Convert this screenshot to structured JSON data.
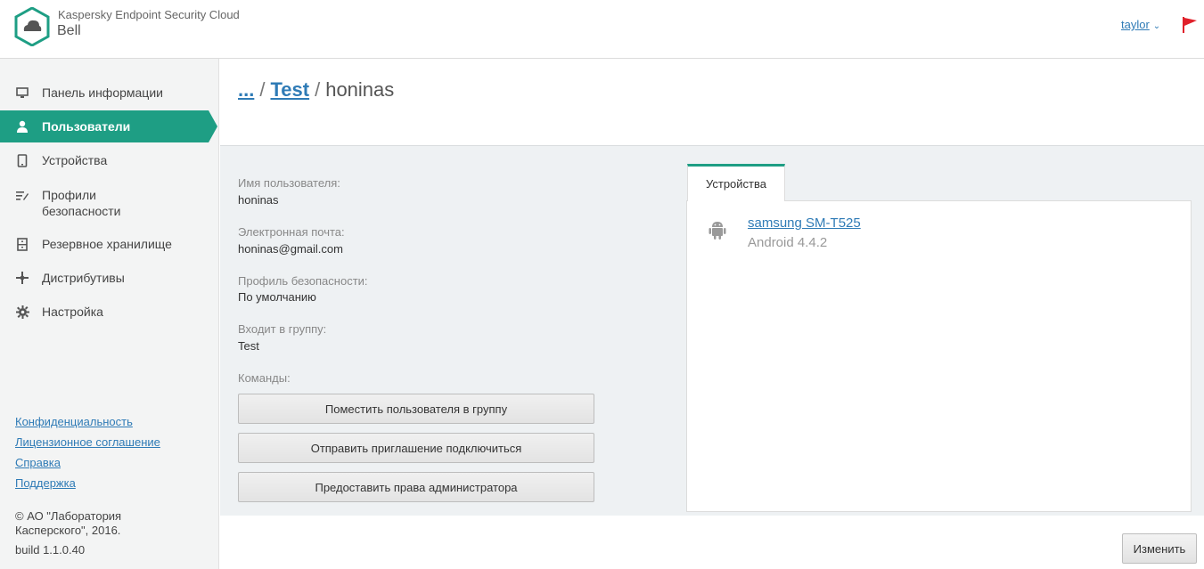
{
  "header": {
    "app_title": "Kaspersky Endpoint Security Cloud",
    "org_name": "Bell",
    "user_name": "taylor",
    "user_menu_icon": "chevron-down-icon",
    "flag_color": "#e0202a",
    "logo_color": "#1e9e84"
  },
  "sidebar": {
    "items": [
      {
        "label": "Панель информации",
        "icon": "monitor-icon",
        "active": false
      },
      {
        "label": "Пользователи",
        "icon": "user-icon",
        "active": true
      },
      {
        "label": "Устройства",
        "icon": "device-icon",
        "active": false
      },
      {
        "label": "Профили безопасности",
        "icon": "profiles-icon",
        "active": false
      },
      {
        "label": "Резервное хранилище",
        "icon": "storage-icon",
        "active": false
      },
      {
        "label": "Дистрибутивы",
        "icon": "distrib-icon",
        "active": false
      },
      {
        "label": "Настройка",
        "icon": "gear-icon",
        "active": false
      }
    ],
    "active_color": "#1e9e84",
    "footer_links": [
      "Конфиденциальность",
      "Лицензионное соглашение",
      "Справка",
      "Поддержка"
    ],
    "copyright": "© АО \"Лаборатория Касперского\", 2016.",
    "build": "build 1.1.0.40"
  },
  "breadcrumb": {
    "root": "...",
    "group": "Test",
    "current": "honinas",
    "separator": "/"
  },
  "user_details": {
    "username_label": "Имя пользователя:",
    "username_value": "honinas",
    "email_label": "Электронная почта:",
    "email_value": "honinas@gmail.com",
    "profile_label": "Профиль безопасности:",
    "profile_value": "По умолчанию",
    "group_label": "Входит в группу:",
    "group_value": "Test",
    "commands_label": "Команды:"
  },
  "commands": {
    "move_to_group": "Поместить пользователя в группу",
    "send_invite": "Отправить приглашение подключиться",
    "grant_admin": "Предоставить права администратора"
  },
  "devices_tab": {
    "label": "Устройства",
    "devices": [
      {
        "name": "samsung SM-T525",
        "os": "Android 4.4.2",
        "icon": "android-icon"
      }
    ]
  },
  "actions": {
    "edit_label": "Изменить"
  }
}
